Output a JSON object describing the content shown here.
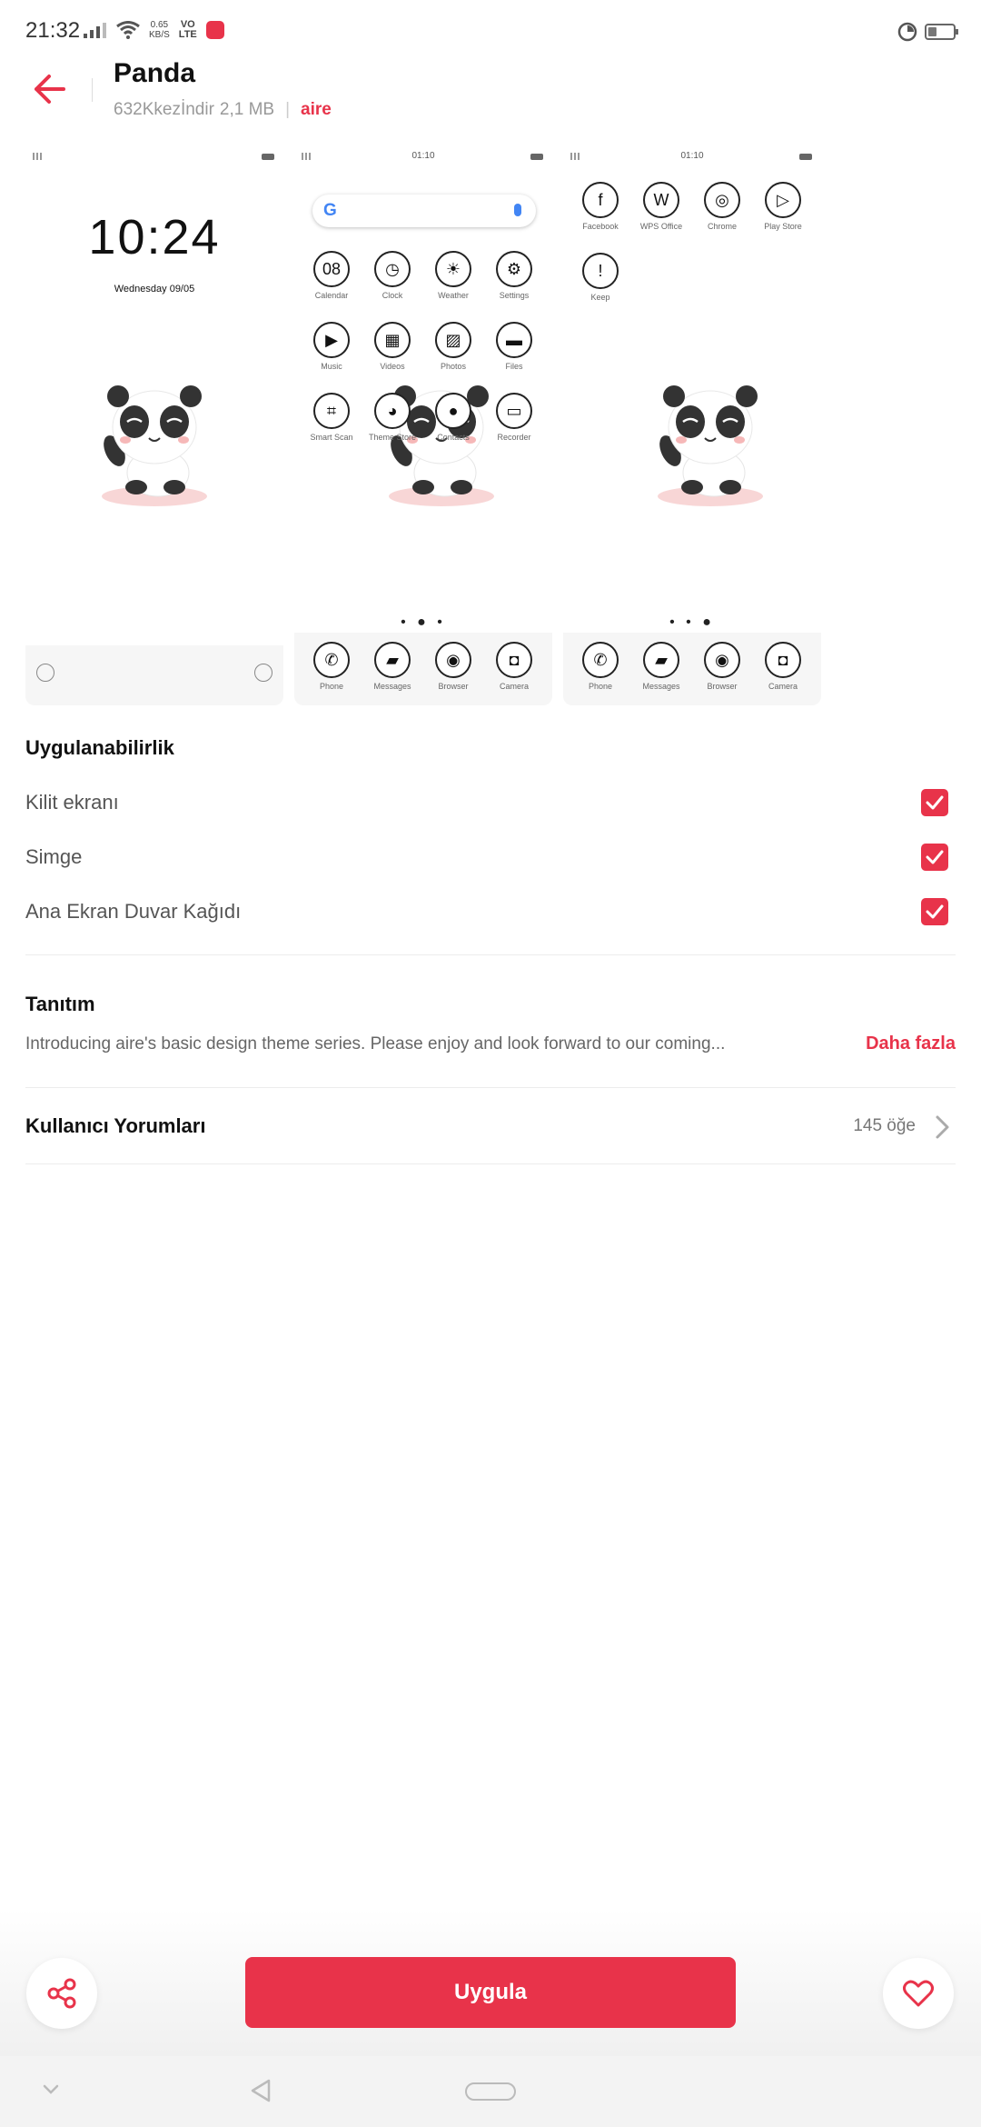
{
  "status_bar": {
    "time": "21:32",
    "net_speed_value": "0.65",
    "net_speed_unit": "KB/S",
    "volte_top": "VO",
    "volte_bottom": "LTE",
    "battery_level": 0.35
  },
  "header": {
    "title": "Panda",
    "downloads": "632Kkezİndir",
    "size": "2,1 MB",
    "author": "aire"
  },
  "previews": {
    "lock": {
      "clock": "10:24",
      "date": "Wednesday 09/05"
    },
    "home1": {
      "status_time": "01:10",
      "search_logo": "G",
      "apps": [
        {
          "label": "Calendar",
          "glyph": "08"
        },
        {
          "label": "Clock",
          "glyph": "◷"
        },
        {
          "label": "Weather",
          "glyph": "☀"
        },
        {
          "label": "Settings",
          "glyph": "⚙"
        },
        {
          "label": "Music",
          "glyph": "▶"
        },
        {
          "label": "Videos",
          "glyph": "▦"
        },
        {
          "label": "Photos",
          "glyph": "▨"
        },
        {
          "label": "Files",
          "glyph": "▬"
        },
        {
          "label": "Smart Scan",
          "glyph": "⌗"
        },
        {
          "label": "Theme Store",
          "glyph": "◕"
        },
        {
          "label": "Contacts",
          "glyph": "●"
        },
        {
          "label": "Recorder",
          "glyph": "▭"
        }
      ],
      "dots": "• ● •",
      "dock": [
        {
          "label": "Phone",
          "glyph": "✆"
        },
        {
          "label": "Messages",
          "glyph": "▰"
        },
        {
          "label": "Browser",
          "glyph": "◉"
        },
        {
          "label": "Camera",
          "glyph": "◘"
        }
      ]
    },
    "home2": {
      "status_time": "01:10",
      "apps": [
        {
          "label": "Facebook",
          "glyph": "f"
        },
        {
          "label": "WPS Office",
          "glyph": "W"
        },
        {
          "label": "Chrome",
          "glyph": "◎"
        },
        {
          "label": "Play Store",
          "glyph": "▷"
        },
        {
          "label": "Keep",
          "glyph": "!"
        }
      ],
      "dots": "• • ●",
      "dock": [
        {
          "label": "Phone",
          "glyph": "✆"
        },
        {
          "label": "Messages",
          "glyph": "▰"
        },
        {
          "label": "Browser",
          "glyph": "◉"
        },
        {
          "label": "Camera",
          "glyph": "◘"
        }
      ]
    }
  },
  "applicability": {
    "title": "Uygulanabilirlik",
    "options": [
      {
        "label": "Kilit ekranı",
        "checked": true
      },
      {
        "label": "Simge",
        "checked": true
      },
      {
        "label": "Ana Ekran Duvar Kağıdı",
        "checked": true
      }
    ]
  },
  "intro": {
    "title": "Tanıtım",
    "text": "Introducing aire's basic design theme series. Please enjoy and look forward to our coming...",
    "more": "Daha fazla"
  },
  "reviews": {
    "title": "Kullanıcı Yorumları",
    "count": "145 öğe"
  },
  "actions": {
    "apply": "Uygula"
  },
  "colors": {
    "accent": "#e8334a",
    "text_secondary": "#555555"
  },
  "icons": {
    "back": "arrow-left-icon",
    "share": "share-icon",
    "favorite": "heart-icon",
    "chevron": "chevron-right-icon"
  }
}
